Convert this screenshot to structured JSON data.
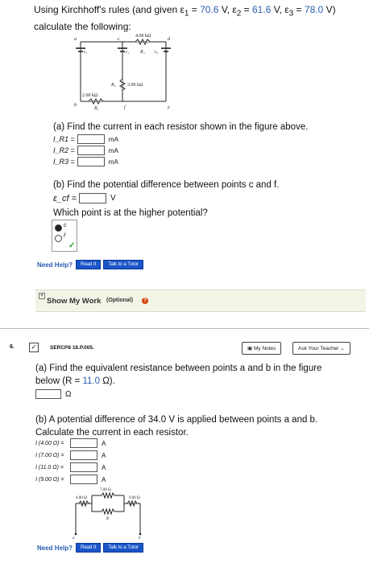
{
  "q1": {
    "intro_a": "Using Kirchhoff's rules (and given ",
    "e1_label": "ε",
    "e1_sub": "1",
    "e1_val": "70.6",
    "e2_label": "ε",
    "e2_sub": "2",
    "e2_val": "61.6",
    "e3_label": "ε",
    "e3_sub": "3",
    "e3_val": "78.0",
    "unit_v": "V",
    "close": ")",
    "line2": "calculate the following:",
    "circuit_labels": {
      "r_top": "4.00 kΩ",
      "e1": "ε₁",
      "e2": "ε₂",
      "r3": "R₃",
      "e3": "ε₃",
      "r2": "R₂",
      "r2_val": "3.00 kΩ",
      "r1_val": "2.00 kΩ",
      "r1": "R₁",
      "a": "a",
      "b": "b",
      "c": "c",
      "d": "d",
      "e": "e",
      "f": "f"
    },
    "part_a": "(a) Find the current in each resistor shown in the figure above.",
    "currents": [
      {
        "label": "I_R1 =",
        "unit": "mA",
        "value": ""
      },
      {
        "label": "I_R2 =",
        "unit": "mA",
        "value": ""
      },
      {
        "label": "I_R3 =",
        "unit": "mA",
        "value": ""
      }
    ],
    "part_b": "(b) Find the potential difference between points c and f.",
    "ecf_label": "ε_cf =",
    "ecf_unit": "V",
    "which_point": "Which point is at the higher potential?",
    "options": [
      "c",
      "f"
    ],
    "selected_option": "c",
    "need_help": "Need Help?",
    "read_it": "Read It",
    "talk_tutor": "Talk to a Tutor",
    "show_work": "Show My Work",
    "optional": "(Optional)"
  },
  "q6": {
    "number": "6.",
    "code": "SERCP8 18.P.005.",
    "my_notes": "My Notes",
    "ask_teacher": "Ask Your Teacher",
    "part_a_1": "(a) Find the equivalent resistance between points a and b in the figure",
    "part_a_2_pre": "below (R = ",
    "r_value": "11.0",
    "part_a_2_post": " Ω).",
    "omega": "Ω",
    "part_b_1": "(b) A potential difference of 34.0 V is applied between points a and b.",
    "part_b_2": "Calculate the current in each resistor.",
    "currents": [
      {
        "label": "I (4.00 Ω) =",
        "unit": "A"
      },
      {
        "label": "I (7.00 Ω) =",
        "unit": "A"
      },
      {
        "label": "I (11.0 Ω) =",
        "unit": "A"
      },
      {
        "label": "I (9.00 Ω) =",
        "unit": "A"
      }
    ],
    "circuit_labels": {
      "r7": "7.00 Ω",
      "r4": "4.00 Ω",
      "r9": "9.00 Ω",
      "r": "R",
      "a": "a",
      "b": "b"
    },
    "need_help": "Need Help?",
    "read_it": "Read It",
    "talk_tutor": "Talk to a Tutor"
  }
}
